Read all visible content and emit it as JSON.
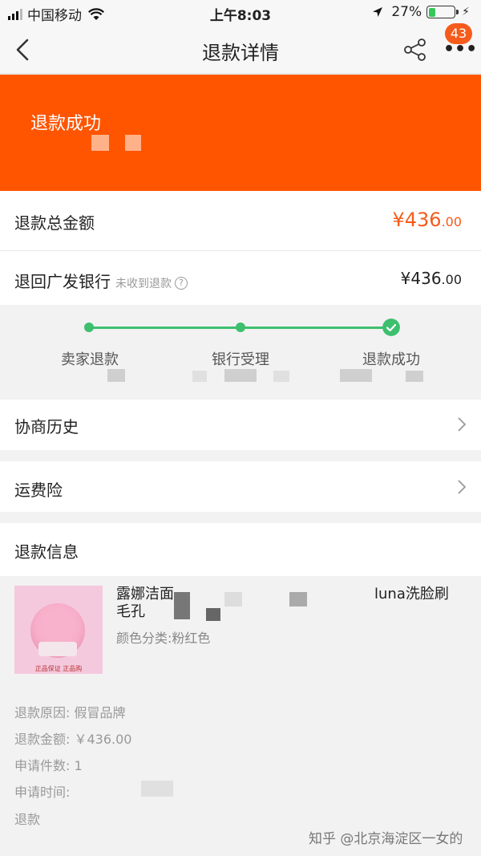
{
  "status_bar": {
    "carrier": "中国移动",
    "time": "上午8:03",
    "battery": "27%",
    "battery_level": 0.27
  },
  "nav": {
    "title": "退款详情",
    "badge": "43"
  },
  "banner": {
    "title": "退款成功"
  },
  "refund_total": {
    "label": "退款总金额",
    "currency": "¥",
    "amount_int": "436",
    "amount_dec": ".00"
  },
  "bank_row": {
    "label": "退回广发银行",
    "note": "未收到退款",
    "amount": "¥436",
    "amount_dec": ".00"
  },
  "progress": {
    "steps": [
      "卖家退款",
      "银行受理",
      "退款成功"
    ]
  },
  "menu": {
    "history": "协商历史",
    "shipping_insurance": "运费险"
  },
  "refund_info": {
    "heading": "退款信息",
    "product_title": "露娜洁面",
    "product_title_tail": "luna洗脸刷",
    "product_title_line2": "毛孔",
    "spec": "颜色分类:粉红色",
    "thumb_text": "正品保证 正品购"
  },
  "details": {
    "reason": "退款原因: 假冒品牌",
    "amount": "退款金额: ￥436.00",
    "quantity": "申请件数: 1",
    "time": "申请时间:",
    "partial": "退款"
  },
  "watermark": "知乎 @北京海淀区一女的"
}
